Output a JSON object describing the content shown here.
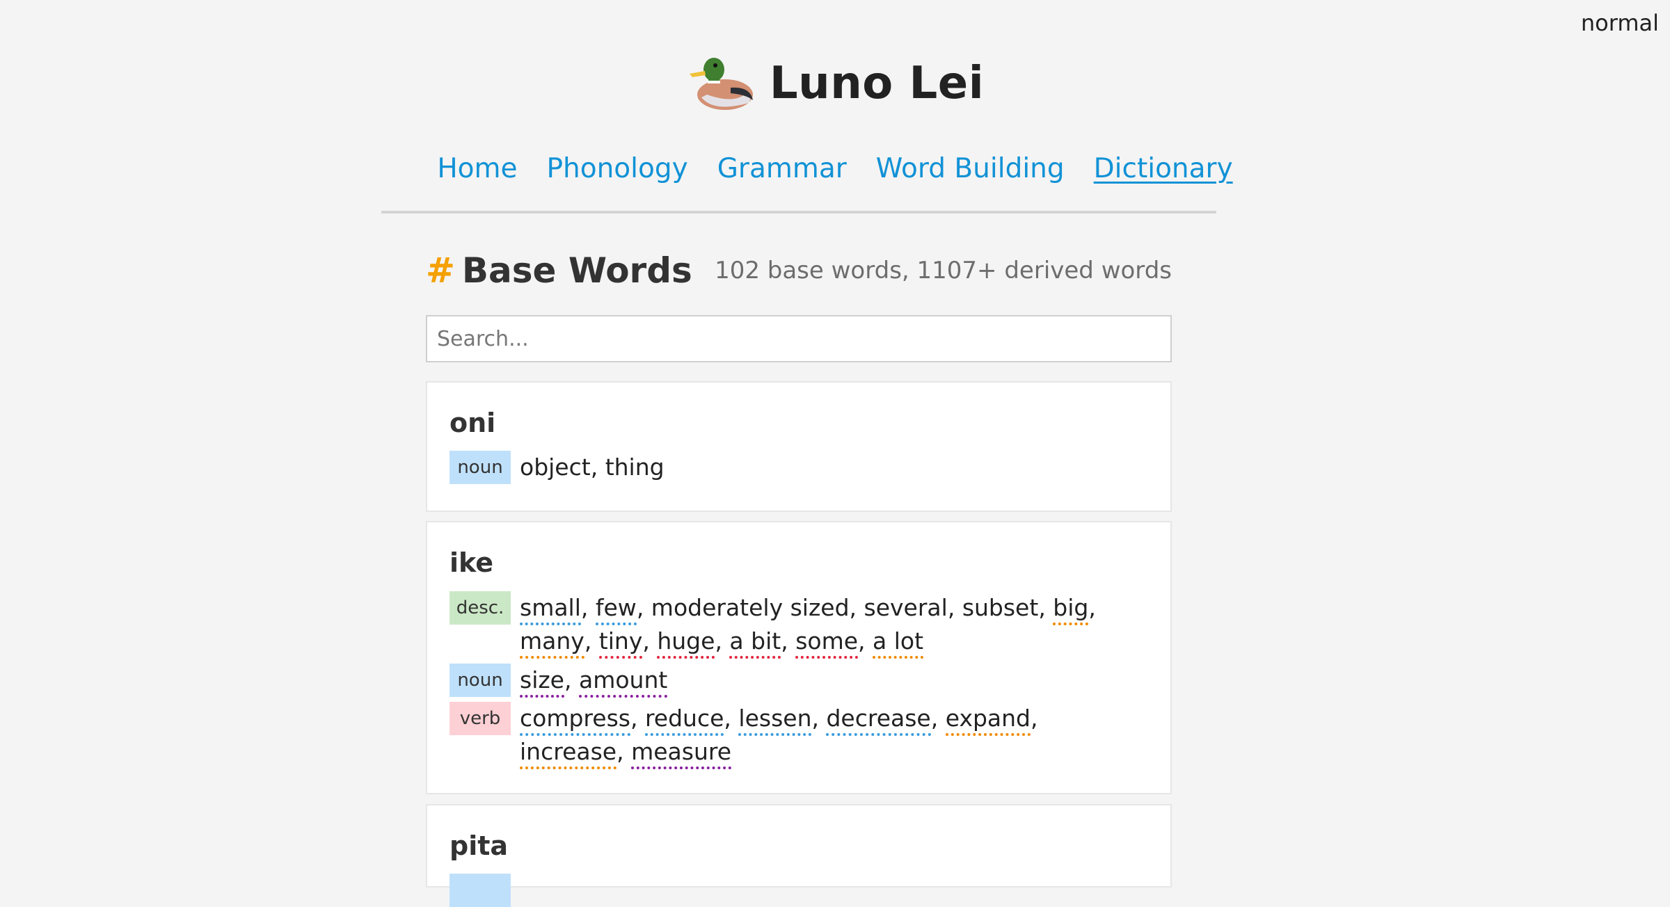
{
  "mode": "normal",
  "site": {
    "title": "Luno Lei",
    "logo_icon": "duck-icon"
  },
  "nav": [
    "Home",
    "Phonology",
    "Grammar",
    "Word Building",
    "Dictionary"
  ],
  "nav_active": "Dictionary",
  "section": {
    "hash": "#",
    "title": "Base Words",
    "stats": "102 base words, 1107+ derived words"
  },
  "search": {
    "placeholder": "Search...",
    "value": ""
  },
  "entries": [
    {
      "word": "oni",
      "senses": [
        {
          "pos": "noun",
          "pos_color": "#bfe0fb",
          "glosses": [
            {
              "text": "object"
            },
            {
              "text": "thing"
            }
          ]
        }
      ]
    },
    {
      "word": "ike",
      "senses": [
        {
          "pos": "desc.",
          "pos_color": "#cbe8c6",
          "glosses": [
            {
              "text": "small",
              "underline": "#3b9bdc"
            },
            {
              "text": "few",
              "underline": "#3b9bdc"
            },
            {
              "text": "moderately sized"
            },
            {
              "text": "several"
            },
            {
              "text": "subset"
            },
            {
              "text": "big",
              "underline": "#f08a00"
            },
            {
              "text": "many",
              "underline": "#f08a00"
            },
            {
              "text": "tiny",
              "underline": "#e2263d"
            },
            {
              "text": "huge",
              "underline": "#e2263d"
            },
            {
              "text": "a bit",
              "underline": "#e2263d"
            },
            {
              "text": "some",
              "underline": "#e2263d"
            },
            {
              "text": "a lot",
              "underline": "#f08a00"
            }
          ]
        },
        {
          "pos": "noun",
          "pos_color": "#bfe0fb",
          "glosses": [
            {
              "text": "size",
              "underline": "#8a1fa0"
            },
            {
              "text": "amount",
              "underline": "#8a1fa0"
            }
          ]
        },
        {
          "pos": "verb",
          "pos_color": "#fdd0d5",
          "glosses": [
            {
              "text": "compress",
              "underline": "#3b9bdc"
            },
            {
              "text": "reduce",
              "underline": "#3b9bdc"
            },
            {
              "text": "lessen",
              "underline": "#3b9bdc"
            },
            {
              "text": "decrease",
              "underline": "#3b9bdc"
            },
            {
              "text": "expand",
              "underline": "#f08a00"
            },
            {
              "text": "increase",
              "underline": "#f08a00"
            },
            {
              "text": "measure",
              "underline": "#8a1fa0"
            }
          ]
        }
      ]
    },
    {
      "word": "pita",
      "senses": [
        {
          "pos": "",
          "pos_color": "#bfe0fb",
          "glosses": []
        }
      ]
    }
  ]
}
